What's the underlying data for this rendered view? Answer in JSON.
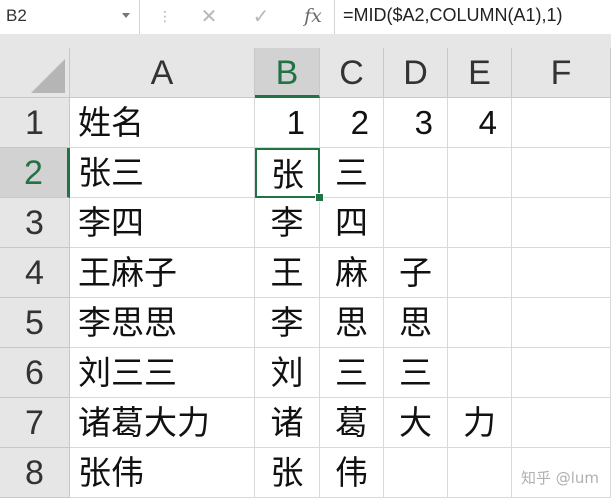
{
  "formula_bar": {
    "name_box": "B2",
    "cancel_icon": "✕",
    "enter_icon": "✓",
    "fx_label": "fx",
    "separator": "⋮",
    "formula": "=MID($A2,COLUMN(A1),1)"
  },
  "columns": [
    "A",
    "B",
    "C",
    "D",
    "E",
    "F"
  ],
  "rows": [
    "1",
    "2",
    "3",
    "4",
    "5",
    "6",
    "7",
    "8"
  ],
  "selected_cell": {
    "column": "B",
    "row": "2"
  },
  "cells": {
    "r1": {
      "A": "姓名",
      "B": "1",
      "C": "2",
      "D": "3",
      "E": "4",
      "F": ""
    },
    "r2": {
      "A": "张三",
      "B": "张",
      "C": "三",
      "D": "",
      "E": "",
      "F": ""
    },
    "r3": {
      "A": "李四",
      "B": "李",
      "C": "四",
      "D": "",
      "E": "",
      "F": ""
    },
    "r4": {
      "A": "王麻子",
      "B": "王",
      "C": "麻",
      "D": "子",
      "E": "",
      "F": ""
    },
    "r5": {
      "A": "李思思",
      "B": "李",
      "C": "思",
      "D": "思",
      "E": "",
      "F": ""
    },
    "r6": {
      "A": "刘三三",
      "B": "刘",
      "C": "三",
      "D": "三",
      "E": "",
      "F": ""
    },
    "r7": {
      "A": "诸葛大力",
      "B": "诸",
      "C": "葛",
      "D": "大",
      "E": "力",
      "F": ""
    },
    "r8": {
      "A": "张伟",
      "B": "张",
      "C": "伟",
      "D": "",
      "E": "",
      "F": ""
    }
  },
  "watermark": "知乎 @lum",
  "colors": {
    "accent": "#217346",
    "header_bg": "#e6e6e6",
    "gridline": "#d9d9d9"
  }
}
